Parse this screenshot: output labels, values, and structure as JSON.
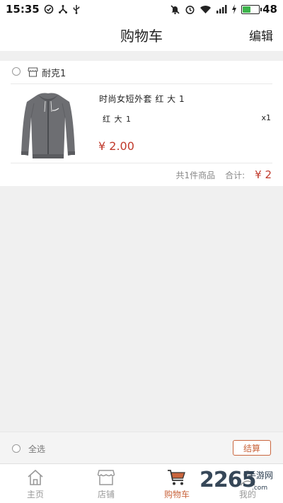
{
  "status_bar": {
    "time": "15:35",
    "battery_level": "48"
  },
  "nav": {
    "title": "购物车",
    "edit_label": "编辑"
  },
  "shop": {
    "name": "耐克1"
  },
  "item": {
    "title": "时尚女短外套 红 大 1",
    "spec": "红 大 1",
    "quantity": "x1",
    "price": "¥ 2.00"
  },
  "summary": {
    "count_text": "共1件商品",
    "total_label": "合计:",
    "total_value": "¥ 2"
  },
  "checkout": {
    "select_all_label": "全选",
    "checkout_label": "结算"
  },
  "tabs": [
    {
      "label": "主页",
      "icon": "home-icon"
    },
    {
      "label": "店铺",
      "icon": "store-icon"
    },
    {
      "label": "购物车",
      "icon": "cart-icon",
      "active": true
    },
    {
      "label": "我的",
      "icon": "profile-icon"
    }
  ],
  "watermark": {
    "number": "2265",
    "text": "手游网",
    "sub": ".com"
  },
  "colors": {
    "accent": "#c9653d",
    "price": "#c0392b",
    "battery": "#3cb44b"
  }
}
